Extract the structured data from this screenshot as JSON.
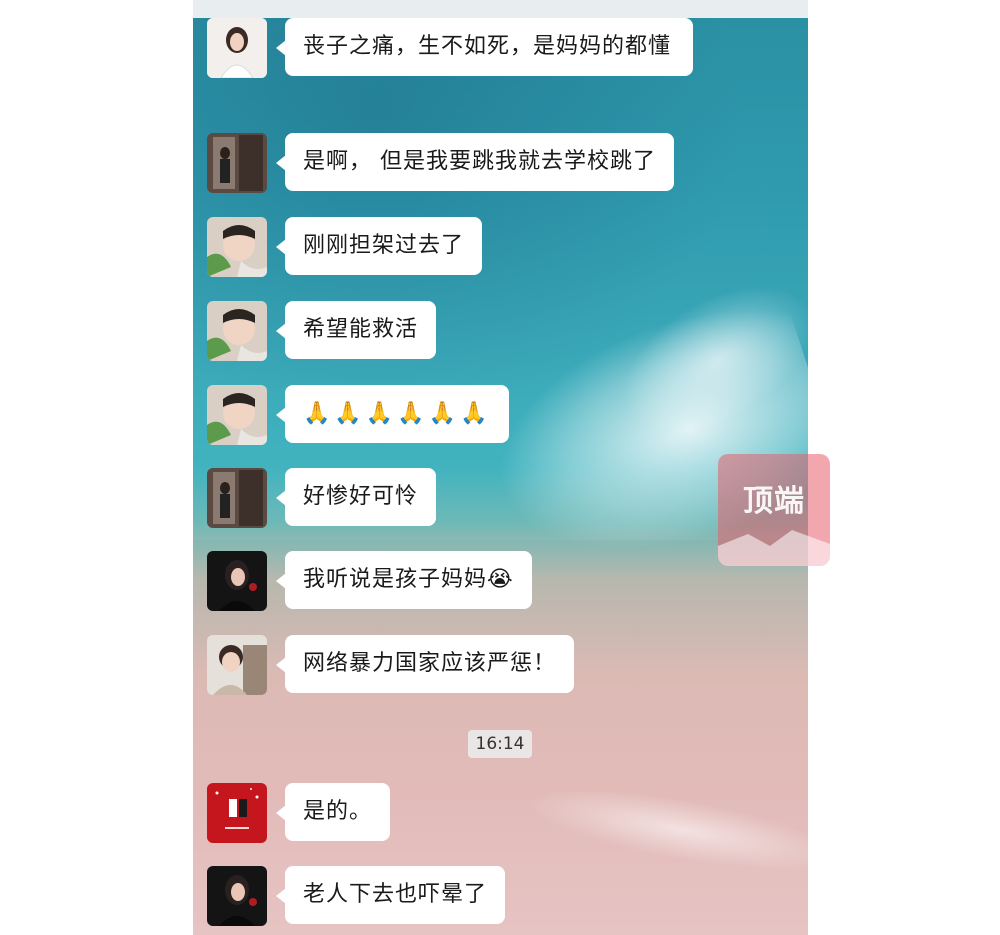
{
  "messages": [
    {
      "text": "丧子之痛，生不如死，是妈妈的都懂",
      "avatar": "woman-white-avatar"
    },
    {
      "text": "是啊， 但是我要跳我就去学校跳了",
      "avatar": "mirror-selfie-avatar"
    },
    {
      "text": "刚刚担架过去了",
      "avatar": "baby-avatar"
    },
    {
      "text": "希望能救活",
      "avatar": "baby-avatar"
    },
    {
      "text": "🙏🙏🙏🙏🙏🙏",
      "avatar": "baby-avatar"
    },
    {
      "text": "好惨好可怜",
      "avatar": "mirror-selfie-avatar"
    },
    {
      "text": "我听说是孩子妈妈😭",
      "avatar": "woman-dark-avatar"
    },
    {
      "text": "网络暴力国家应该严惩！",
      "avatar": "child-avatar"
    },
    {
      "text": "是的。",
      "avatar": "red-card-avatar"
    },
    {
      "text": "老人下去也吓晕了",
      "avatar": "woman-dark-avatar"
    }
  ],
  "timestamp": "16:14",
  "watermark": "顶端",
  "colors": {
    "bubble": "#ffffff",
    "water": "#2f9aae",
    "sand": "#e2bbb9",
    "watermark": "#e65f69"
  }
}
